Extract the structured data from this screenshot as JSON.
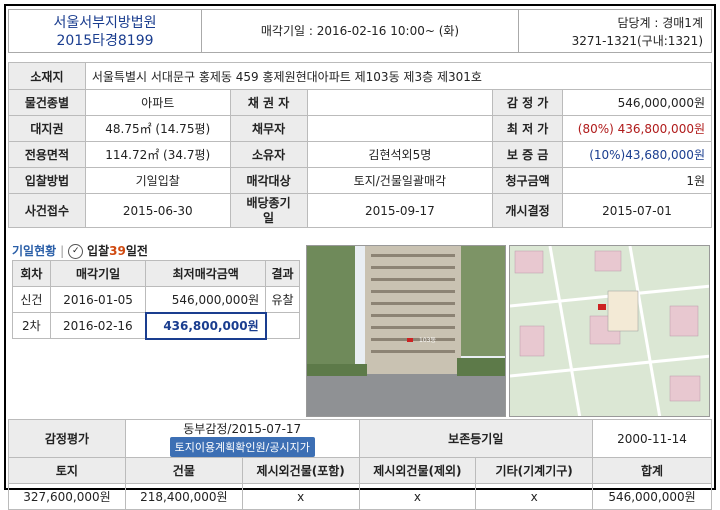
{
  "header": {
    "court": "서울서부지방법원",
    "case_no": "2015타경8199",
    "sale_date": "매각기일 : 2016-02-16   10:00~ (화)",
    "dept": "담당계 : 경매1계",
    "phone": "3271-1321(구내:1321)"
  },
  "info": {
    "address_label": "소재지",
    "address": "서울특별시 서대문구 홍제동 459 홍제원현대아파트 제103동 제3층 제301호",
    "type_label": "물건종별",
    "type": "아파트",
    "creditor_label": "채 권 자",
    "creditor": "",
    "appraisal_label": "감 정 가",
    "appraisal": "546,000,000원",
    "land_label": "대지권",
    "land": "48.75㎡ (14.75평)",
    "debtor_label": "채무자",
    "debtor": "",
    "minprice_label": "최 저 가",
    "minprice": "(80%) 436,800,000원",
    "area_label": "전용면적",
    "area": "114.72㎡ (34.7평)",
    "owner_label": "소유자",
    "owner": "김현석외5명",
    "deposit_label": "보 증 금",
    "deposit": "(10%)43,680,000원",
    "method_label": "입찰방법",
    "method": "기일입찰",
    "target_label": "매각대상",
    "target": "토지/건물일괄매각",
    "claim_label": "청구금액",
    "claim": "1원",
    "received_label": "사건접수",
    "received": "2015-06-30",
    "dividend_label": "배당종기일",
    "dividend": "2015-09-17",
    "started_label": "개시결정",
    "started": "2015-07-01"
  },
  "status_bar": {
    "title": "기일현황",
    "bid_prefix": "입찰",
    "days": "39",
    "suffix": "일전"
  },
  "rounds": {
    "headers": [
      "회차",
      "매각기일",
      "최저매각금액",
      "결과"
    ],
    "rows": [
      {
        "round": "신건",
        "date": "2016-01-05",
        "price": "546,000,000원",
        "result": "유찰"
      },
      {
        "round": "2차",
        "date": "2016-02-16",
        "price": "436,800,000원",
        "result": ""
      }
    ]
  },
  "photo": {
    "label": "103동"
  },
  "bottom": {
    "appraisal_label": "감정평가",
    "appraisal_value": "동부감정/2015-07-17",
    "link_label": "토지이용계획확인원/공시지가",
    "reg_label": "보존등기일",
    "reg_value": "2000-11-14",
    "headers": [
      "토지",
      "건물",
      "제시외건물(포함)",
      "제시외건물(제외)",
      "기타(기계기구)",
      "합계"
    ],
    "values": [
      "327,600,000원",
      "218,400,000원",
      "x",
      "x",
      "x",
      "546,000,000원"
    ]
  },
  "colors": {
    "accent": "#1a3d8f",
    "red": "#b01b1b",
    "label_bg": "#ececec"
  }
}
